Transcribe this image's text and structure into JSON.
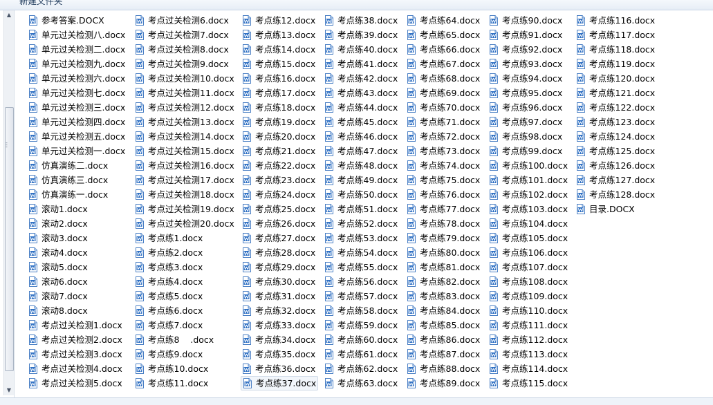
{
  "toolbar": {
    "new_folder_label": "新建文件夹"
  },
  "icon": "word-document-icon",
  "selected_file": "考点练37.docx",
  "columns": [
    [
      "参考答案.DOCX",
      "单元过关检测八.docx",
      "单元过关检测二.docx",
      "单元过关检测九.docx",
      "单元过关检测六.docx",
      "单元过关检测七.docx",
      "单元过关检测三.docx",
      "单元过关检测四.docx",
      "单元过关检测五.docx",
      "单元过关检测一.docx",
      "仿真演练二.docx",
      "仿真演练三.docx",
      "仿真演练一.docx",
      "滚动1.docx",
      "滚动2.docx",
      "滚动3.docx",
      "滚动4.docx",
      "滚动5.docx",
      "滚动6.docx",
      "滚动7.docx",
      "滚动8.docx",
      "考点过关检测1.docx",
      "考点过关检测2.docx",
      "考点过关检测3.docx",
      "考点过关检测4.docx",
      "考点过关检测5.docx"
    ],
    [
      "考点过关检测6.docx",
      "考点过关检测7.docx",
      "考点过关检测8.docx",
      "考点过关检测9.docx",
      "考点过关检测10.docx",
      "考点过关检测11.docx",
      "考点过关检测12.docx",
      "考点过关检测13.docx",
      "考点过关检测14.docx",
      "考点过关检测15.docx",
      "考点过关检测16.docx",
      "考点过关检测17.docx",
      "考点过关检测18.docx",
      "考点过关检测19.docx",
      "考点过关检测20.docx",
      "考点练1.docx",
      "考点练2.docx",
      "考点练3.docx",
      "考点练4.docx",
      "考点练5.docx",
      "考点练6.docx",
      "考点练7.docx",
      "考点练8    .docx",
      "考点练9.docx",
      "考点练10.docx",
      "考点练11.docx"
    ],
    [
      "考点练12.docx",
      "考点练13.docx",
      "考点练14.docx",
      "考点练15.docx",
      "考点练16.docx",
      "考点练17.docx",
      "考点练18.docx",
      "考点练19.docx",
      "考点练20.docx",
      "考点练21.docx",
      "考点练22.docx",
      "考点练23.docx",
      "考点练24.docx",
      "考点练25.docx",
      "考点练26.docx",
      "考点练27.docx",
      "考点练28.docx",
      "考点练29.docx",
      "考点练30.docx",
      "考点练31.docx",
      "考点练32.docx",
      "考点练33.docx",
      "考点练34.docx",
      "考点练35.docx",
      "考点练36.docx",
      "考点练37.docx"
    ],
    [
      "考点练38.docx",
      "考点练39.docx",
      "考点练40.docx",
      "考点练41.docx",
      "考点练42.docx",
      "考点练43.docx",
      "考点练44.docx",
      "考点练45.docx",
      "考点练46.docx",
      "考点练47.docx",
      "考点练48.docx",
      "考点练49.docx",
      "考点练50.docx",
      "考点练51.docx",
      "考点练52.docx",
      "考点练53.docx",
      "考点练54.docx",
      "考点练55.docx",
      "考点练56.docx",
      "考点练57.docx",
      "考点练58.docx",
      "考点练59.docx",
      "考点练60.docx",
      "考点练61.docx",
      "考点练62.docx",
      "考点练63.docx"
    ],
    [
      "考点练64.docx",
      "考点练65.docx",
      "考点练66.docx",
      "考点练67.docx",
      "考点练68.docx",
      "考点练69.docx",
      "考点练70.docx",
      "考点练71.docx",
      "考点练72.docx",
      "考点练73.docx",
      "考点练74.docx",
      "考点练75.docx",
      "考点练76.docx",
      "考点练77.docx",
      "考点练78.docx",
      "考点练79.docx",
      "考点练80.docx",
      "考点练81.docx",
      "考点练82.docx",
      "考点练83.docx",
      "考点练84.docx",
      "考点练85.docx",
      "考点练86.docx",
      "考点练87.docx",
      "考点练88.docx",
      "考点练89.docx"
    ],
    [
      "考点练90.docx",
      "考点练91.docx",
      "考点练92.docx",
      "考点练93.docx",
      "考点练94.docx",
      "考点练95.docx",
      "考点练96.docx",
      "考点练97.docx",
      "考点练98.docx",
      "考点练99.docx",
      "考点练100.docx",
      "考点练101.docx",
      "考点练102.docx",
      "考点练103.docx",
      "考点练104.docx",
      "考点练105.docx",
      "考点练106.docx",
      "考点练107.docx",
      "考点练108.docx",
      "考点练109.docx",
      "考点练110.docx",
      "考点练111.docx",
      "考点练112.docx",
      "考点练113.docx",
      "考点练114.docx",
      "考点练115.docx"
    ],
    [
      "考点练116.docx",
      "考点练117.docx",
      "考点练118.docx",
      "考点练119.docx",
      "考点练120.docx",
      "考点练121.docx",
      "考点练122.docx",
      "考点练123.docx",
      "考点练124.docx",
      "考点练125.docx",
      "考点练126.docx",
      "考点练127.docx",
      "考点练128.docx",
      "目录.DOCX"
    ]
  ]
}
